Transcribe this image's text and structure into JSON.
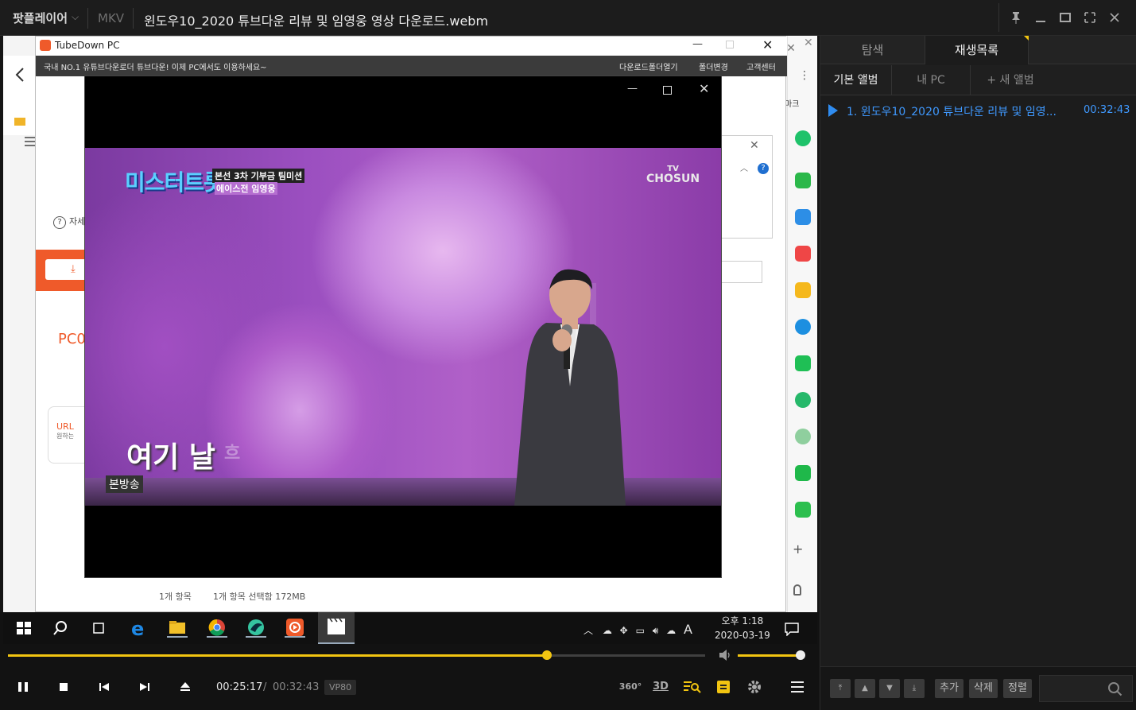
{
  "app": {
    "name": "팟플레이어",
    "format": "MKV",
    "title": "윈도우10_2020 튜브다운 리뷰 및 임영웅 영상 다운로드.webm"
  },
  "tubedown": {
    "title": "TubeDown PC",
    "notice": "국내 NO.1 유튜브다운로더 튜브다운! 이제 PC에서도 이용하세요~",
    "menu": [
      "다운로드폴더열기",
      "폴더변경",
      "고객센터"
    ],
    "pc_label": "PC0",
    "url_label": "URL",
    "url_sub": "원하는",
    "help_label": "자세"
  },
  "explorer": {
    "items_count": "1개 항목",
    "selected": "1개 항목 선택함 172MB"
  },
  "browser": {
    "bookmark_label": "마크"
  },
  "video": {
    "logo": "미스터트롯",
    "subtitle1": "본선 3차 기부금 팀미션",
    "subtitle2": "에이스전 임영웅",
    "channel_top": "TV",
    "channel_bottom": "CHOSUN",
    "lyric": "여기 날",
    "lyric_fade": "흐",
    "badge": "본방송"
  },
  "taskbar": {
    "time": "오후 1:18",
    "date": "2020-03-19",
    "ime": "A"
  },
  "playback": {
    "current": "00:25:17",
    "separator": "/",
    "duration": "00:32:43",
    "codec": "VP80",
    "progress": 0.773,
    "volume": 1.0
  },
  "playlist": {
    "tabs": [
      "탐색",
      "재생목록"
    ],
    "subtabs": [
      "기본 앨범",
      "내 PC",
      "+ 새 앨범"
    ],
    "items": [
      {
        "title": "1. 윈도우10_2020 튜브다운 리뷰 및 임영...",
        "duration": "00:32:43"
      }
    ],
    "buttons": [
      "추가",
      "삭제",
      "정렬"
    ]
  },
  "colors": {
    "accent": "#f2c511",
    "playlist_active": "#3f99ff",
    "tubedown_brand": "#ef5a2a"
  }
}
